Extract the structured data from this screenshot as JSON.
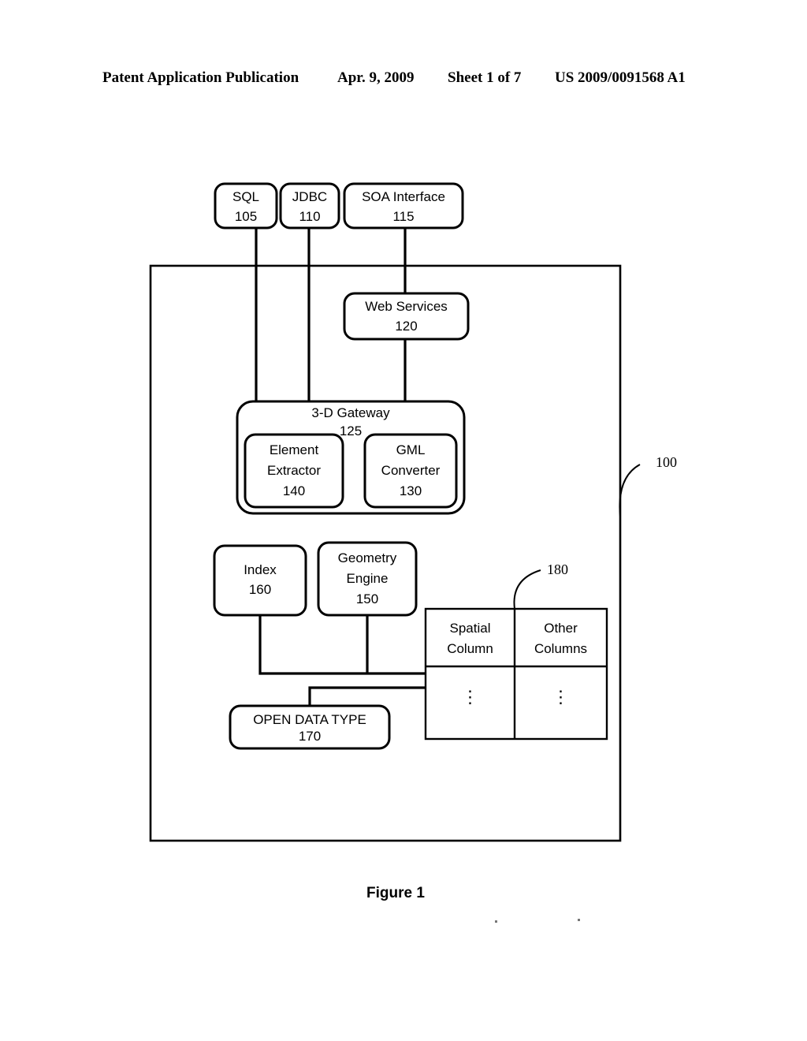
{
  "header": {
    "publication": "Patent Application Publication",
    "date": "Apr. 9, 2009",
    "sheet": "Sheet 1 of 7",
    "patent_number": "US 2009/0091568 A1"
  },
  "figure": {
    "caption": "Figure 1",
    "system_reference": "100",
    "table_reference": "180"
  },
  "nodes": {
    "sql": {
      "title": "SQL",
      "ref": "105"
    },
    "jdbc": {
      "title": "JDBC",
      "ref": "110"
    },
    "soa": {
      "title": "SOA Interface",
      "ref": "115"
    },
    "web_services": {
      "title": "Web Services",
      "ref": "120"
    },
    "gateway": {
      "title": "3-D Gateway",
      "ref": "125"
    },
    "element_extractor": {
      "line1": "Element",
      "line2": "Extractor",
      "ref": "140"
    },
    "gml_converter": {
      "line1": "GML",
      "line2": "Converter",
      "ref": "130"
    },
    "index": {
      "title": "Index",
      "ref": "160"
    },
    "geometry_engine": {
      "line1": "Geometry",
      "line2": "Engine",
      "ref": "150"
    },
    "open_data_type": {
      "title": "OPEN DATA TYPE",
      "ref": "170"
    }
  },
  "table": {
    "columns": [
      {
        "line1": "Spatial",
        "line2": "Column",
        "cell": "⋮"
      },
      {
        "line1": "Other",
        "line2": "Columns",
        "cell": "⋮"
      }
    ]
  },
  "colors": {
    "ink": "#000000",
    "paper": "#ffffff"
  }
}
